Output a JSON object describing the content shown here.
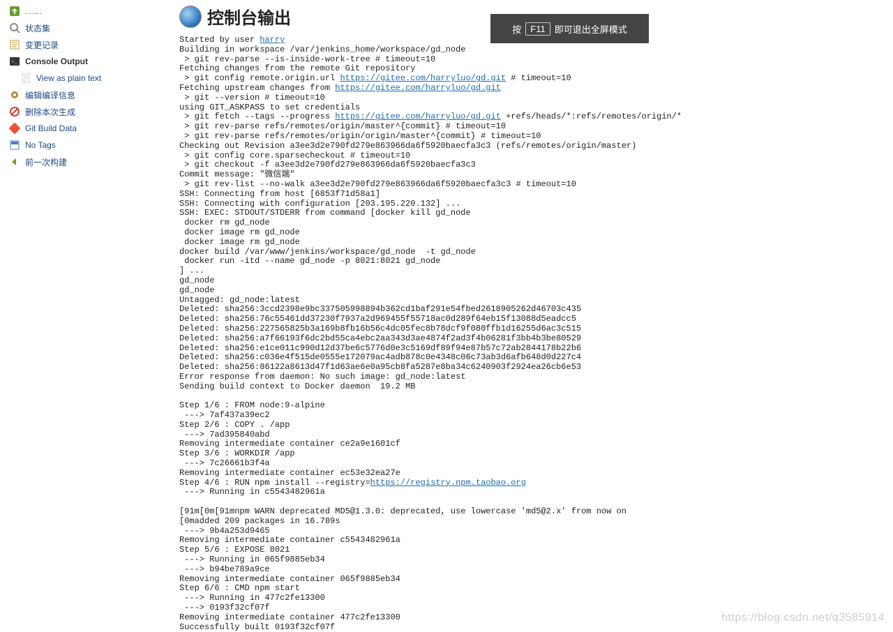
{
  "fullscreen_tip": {
    "prefix": "按",
    "key": "F11",
    "suffix": "即可退出全屏模式"
  },
  "page_title": "控制台输出",
  "sidebar": {
    "items": [
      {
        "name": "back-to-project",
        "label": "……",
        "icon": "green-arrow"
      },
      {
        "name": "status",
        "label": "状态集",
        "icon": "magnifier"
      },
      {
        "name": "changes",
        "label": "变更记录",
        "icon": "note"
      },
      {
        "name": "console-output",
        "label": "Console Output",
        "icon": "terminal",
        "active": true
      },
      {
        "name": "view-as-plain-text",
        "label": "View as plain text",
        "icon": "doc",
        "sub": true
      },
      {
        "name": "edit-build-info",
        "label": "编辑编译信息",
        "icon": "gear"
      },
      {
        "name": "delete-build",
        "label": "删除本次生成",
        "icon": "forbidden"
      },
      {
        "name": "git-build-data",
        "label": "Git Build Data",
        "icon": "git"
      },
      {
        "name": "no-tags",
        "label": "No Tags",
        "icon": "tag"
      },
      {
        "name": "previous-build",
        "label": "前一次构建",
        "icon": "left-arrow"
      }
    ]
  },
  "console": {
    "started_by_prefix": "Started by user ",
    "user_link": "harry",
    "l01": "Building in workspace /var/jenkins_home/workspace/gd_node",
    "l02": " > git rev-parse --is-inside-work-tree # timeout=10",
    "l03": "Fetching changes from the remote Git repository",
    "l04_prefix": " > git config remote.origin.url ",
    "l04_link": "https://gitee.com/harryluo/gd.git",
    "l04_suffix": " # timeout=10",
    "l05_prefix": "Fetching upstream changes from ",
    "l05_link": "https://gitee.com/harryluo/gd.git",
    "l06": " > git --version # timeout=10",
    "l07": "using GIT_ASKPASS to set credentials ",
    "l08_prefix": " > git fetch --tags --progress ",
    "l08_link": "https://gitee.com/harryluo/gd.git",
    "l08_suffix": " +refs/heads/*:refs/remotes/origin/*",
    "l09": " > git rev-parse refs/remotes/origin/master^{commit} # timeout=10",
    "l10": " > git rev-parse refs/remotes/origin/origin/master^{commit} # timeout=10",
    "l11": "Checking out Revision a3ee3d2e790fd279e863966da6f5920baecfa3c3 (refs/remotes/origin/master)",
    "l12": " > git config core.sparsecheckout # timeout=10",
    "l13": " > git checkout -f a3ee3d2e790fd279e863966da6f5920baecfa3c3",
    "l14": "Commit message: \"微信端\"",
    "l15": " > git rev-list --no-walk a3ee3d2e790fd279e863966da6f5920baecfa3c3 # timeout=10",
    "l16": "SSH: Connecting from host [6853f71d58a1]",
    "l17": "SSH: Connecting with configuration [203.195.220.132] ...",
    "l18": "SSH: EXEC: STDOUT/STDERR from command [docker kill gd_node",
    "l19": " docker rm gd_node",
    "l20": " docker image rm gd_node",
    "l21": " docker image rm gd_node",
    "l22": "docker build /var/www/jenkins/workspace/gd_node  -t gd_node",
    "l23": " docker run -itd --name gd_node -p 8021:8021 gd_node",
    "l24": "] ...",
    "l25": "gd_node",
    "l26": "gd_node",
    "l27": "Untagged: gd_node:latest",
    "l28": "Deleted: sha256:3ccd2398e9bc337505998894b362cd1baf291e54fbed2618905262d46703c435",
    "l29": "Deleted: sha256:76c55461dd37230f7937a2d969455f55718ac0d289f64eb15f13088d5eadcc5",
    "l30": "Deleted: sha256:227565825b3a169b8fb16b56c4dc05fec8b78dcf9f080ffb1d16255d6ac3c515",
    "l31": "Deleted: sha256:a7f66193f6dc2bd55ca4ebc2aa343d3ae4874f2ad3f4b06281f3bb4b3be80529",
    "l32": "Deleted: sha256:e1ce011c990d12d37be6c5776d0e3c5169df89f94e87b57c72ab2844178b22b6",
    "l33": "Deleted: sha256:c036e4f515de0555e172079ac4adb878c0e4348c06c73ab3d6afb648d0d227c4",
    "l34": "Deleted: sha256:86122a8613d47f1d63ae6e0a95cb8fa5287e8ba34c6240903f2924ea26cb6e53",
    "l35": "Error response from daemon: No such image: gd_node:latest",
    "l36": "Sending build context to Docker daemon  19.2 MB",
    "l37": "",
    "l38": "Step 1/6 : FROM node:9-alpine",
    "l39": " ---> 7af437a39ec2",
    "l40": "Step 2/6 : COPY . /app",
    "l41": " ---> 7ad395840abd",
    "l42": "Removing intermediate container ce2a9e1601cf",
    "l43": "Step 3/6 : WORKDIR /app",
    "l44": " ---> 7c26661b3f4a",
    "l45": "Removing intermediate container ec53e32ea27e",
    "l46_prefix": "Step 4/6 : RUN npm install --registry=",
    "l46_link": "https://registry.npm.taobao.org",
    "l47": " ---> Running in c5543482961a",
    "l48": "",
    "l49": "\u001b[91m\u001b[0m\u001b[91mnpm WARN deprecated MD5@1.3.0: deprecated, use lowercase 'md5@2.x' from now on",
    "l50": "\u001b[0madded 209 packages in 16.789s",
    "l51": " ---> 9b4a253d9465",
    "l52": "Removing intermediate container c5543482961a",
    "l53": "Step 5/6 : EXPOSE 8021",
    "l54": " ---> Running in 065f9885eb34",
    "l55": " ---> b94be789a9ce",
    "l56": "Removing intermediate container 065f9885eb34",
    "l57": "Step 6/6 : CMD npm start",
    "l58": " ---> Running in 477c2fe13300",
    "l59": " ---> 0193f32cf07f",
    "l60": "Removing intermediate container 477c2fe13300",
    "l61": "Successfully built 0193f32cf07f"
  },
  "watermark": "https://blog.csdn.net/q3585914"
}
